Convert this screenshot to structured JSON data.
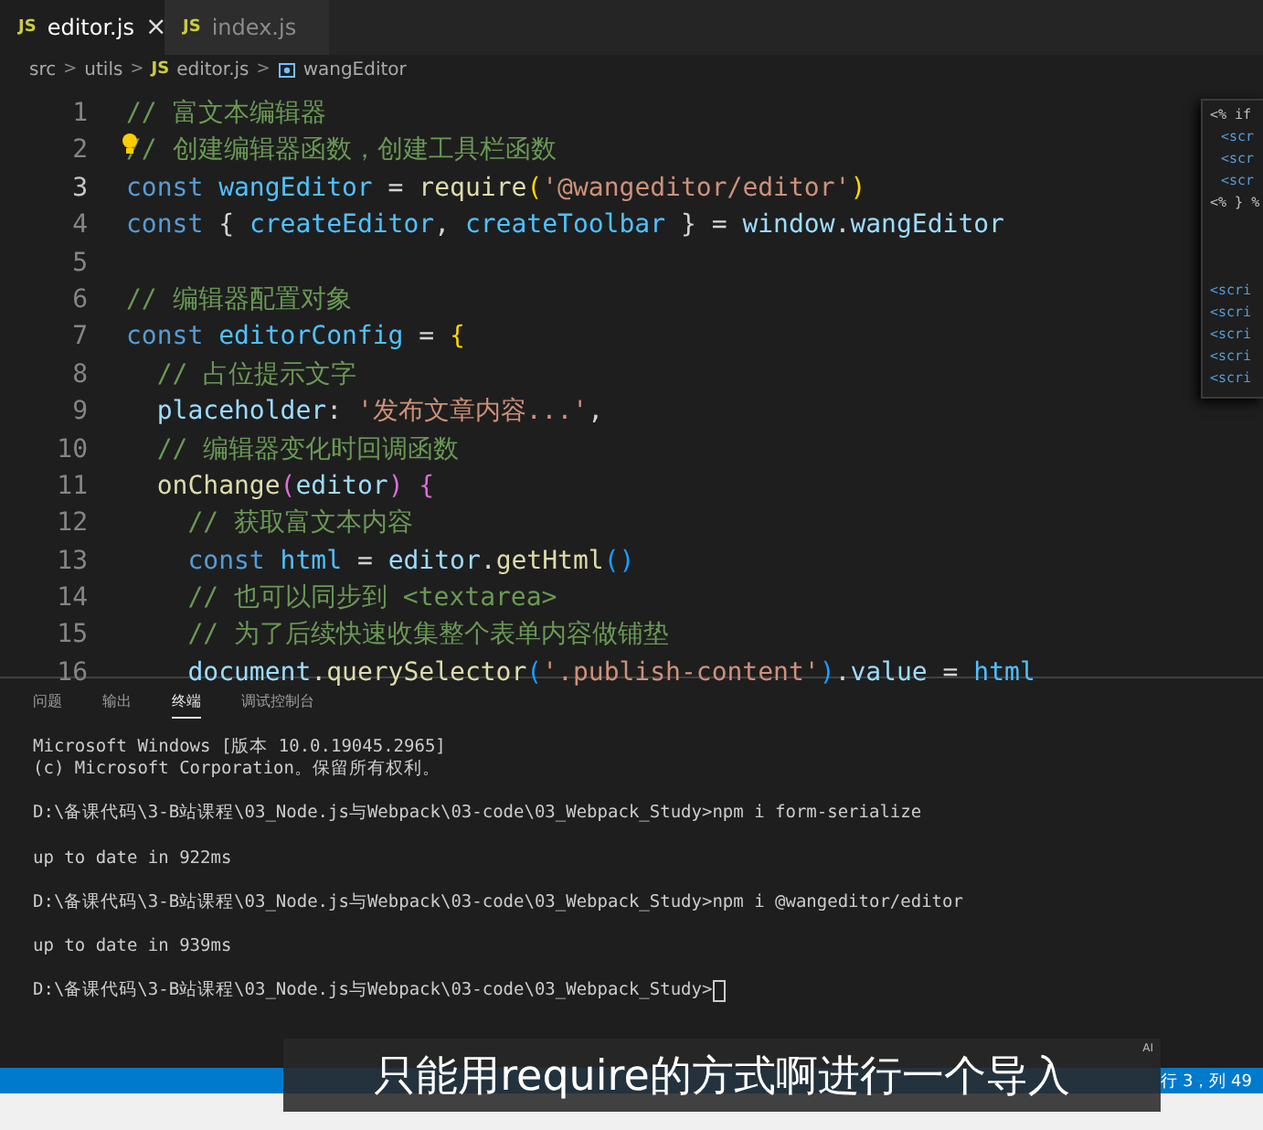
{
  "tabs": [
    {
      "label": "editor.js",
      "icon": "JS",
      "selected": true,
      "close": "×"
    },
    {
      "label": "index.js",
      "icon": "JS",
      "selected": false
    }
  ],
  "breadcrumb_separator": ">",
  "breadcrumb": [
    {
      "kind": "folder",
      "text": "src"
    },
    {
      "kind": "folder",
      "text": "utils"
    },
    {
      "kind": "file",
      "icon": "JS",
      "text": "editor.js"
    },
    {
      "kind": "symbol",
      "text": "wangEditor"
    }
  ],
  "code_lines": [
    {
      "number": "1",
      "current": false,
      "tokens": [
        {
          "kind": "comment",
          "text": "// 富文本编辑器"
        }
      ]
    },
    {
      "number": "2",
      "current": false,
      "lightbulb": true,
      "tokens": [
        {
          "kind": "comment",
          "text": "// 创建编辑器函数，创建工具栏函数"
        }
      ]
    },
    {
      "number": "3",
      "current": true,
      "tokens": [
        {
          "kind": "keyword",
          "text": "const "
        },
        {
          "kind": "variable",
          "text": "wangEditor"
        },
        {
          "kind": "plain",
          "text": " = "
        },
        {
          "kind": "func",
          "text": "require"
        },
        {
          "kind": "bracket",
          "text": "("
        },
        {
          "kind": "string",
          "text": "'@wangeditor/editor'"
        },
        {
          "kind": "bracket",
          "text": ")"
        }
      ]
    },
    {
      "number": "4",
      "current": false,
      "tokens": [
        {
          "kind": "keyword",
          "text": "const "
        },
        {
          "kind": "plain",
          "text": "{ "
        },
        {
          "kind": "variable",
          "text": "createEditor"
        },
        {
          "kind": "plain",
          "text": ", "
        },
        {
          "kind": "variable",
          "text": "createToolbar"
        },
        {
          "kind": "plain",
          "text": " } = "
        },
        {
          "kind": "property",
          "text": "window"
        },
        {
          "kind": "plain",
          "text": "."
        },
        {
          "kind": "property",
          "text": "wangEditor"
        }
      ]
    },
    {
      "number": "5",
      "current": false
    },
    {
      "number": "6",
      "current": false,
      "tokens": [
        {
          "kind": "comment",
          "text": "// 编辑器配置对象"
        }
      ]
    },
    {
      "number": "7",
      "current": false,
      "tokens": [
        {
          "kind": "keyword",
          "text": "const "
        },
        {
          "kind": "variable",
          "text": "editorConfig"
        },
        {
          "kind": "plain",
          "text": " = "
        },
        {
          "kind": "bracket",
          "text": "{"
        }
      ]
    },
    {
      "number": "8",
      "current": false,
      "tokens": [
        {
          "kind": "comment",
          "text": "  // 占位提示文字"
        }
      ]
    },
    {
      "number": "9",
      "current": false,
      "tokens": [
        {
          "kind": "property",
          "text": "  placeholder"
        },
        {
          "kind": "plain",
          "text": ": "
        },
        {
          "kind": "string",
          "text": "'发布文章内容...'"
        },
        {
          "kind": "plain",
          "text": ","
        }
      ]
    },
    {
      "number": "10",
      "current": false,
      "tokens": [
        {
          "kind": "comment",
          "text": "  // 编辑器变化时回调函数"
        }
      ]
    },
    {
      "number": "11",
      "current": false,
      "tokens": [
        {
          "kind": "func",
          "text": "  onChange"
        },
        {
          "kind": "bracket2",
          "text": "("
        },
        {
          "kind": "property",
          "text": "editor"
        },
        {
          "kind": "bracket2",
          "text": ") {"
        }
      ]
    },
    {
      "number": "12",
      "current": false,
      "tokens": [
        {
          "kind": "comment",
          "text": "    // 获取富文本内容"
        }
      ]
    },
    {
      "number": "13",
      "current": false,
      "tokens": [
        {
          "kind": "keyword",
          "text": "    const "
        },
        {
          "kind": "variable",
          "text": "html"
        },
        {
          "kind": "plain",
          "text": " = "
        },
        {
          "kind": "property",
          "text": "editor"
        },
        {
          "kind": "plain",
          "text": "."
        },
        {
          "kind": "func",
          "text": "getHtml"
        },
        {
          "kind": "bracket3",
          "text": "()"
        }
      ]
    },
    {
      "number": "14",
      "current": false,
      "tokens": [
        {
          "kind": "comment",
          "text": "    // 也可以同步到 <textarea>"
        }
      ]
    },
    {
      "number": "15",
      "current": false,
      "tokens": [
        {
          "kind": "comment",
          "text": "    // 为了后续快速收集整个表单内容做铺垫"
        }
      ]
    },
    {
      "number": "16",
      "current": false,
      "tokens": [
        {
          "kind": "property",
          "text": "    document"
        },
        {
          "kind": "plain",
          "text": "."
        },
        {
          "kind": "func",
          "text": "querySelector"
        },
        {
          "kind": "bracket3",
          "text": "("
        },
        {
          "kind": "string",
          "text": "'.publish-content'"
        },
        {
          "kind": "bracket3",
          "text": ")"
        },
        {
          "kind": "plain",
          "text": "."
        },
        {
          "kind": "property",
          "text": "value"
        },
        {
          "kind": "plain",
          "text": " = "
        },
        {
          "kind": "variable",
          "text": "html"
        }
      ]
    }
  ],
  "peek_lines": [
    {
      "kind": "tag",
      "text": "<% if"
    },
    {
      "kind": "script",
      "text": "<scr"
    },
    {
      "kind": "script",
      "text": "<scr"
    },
    {
      "kind": "script",
      "text": "<scr"
    },
    {
      "kind": "tag",
      "text": "<% } %"
    },
    {
      "kind": "gap",
      "text": "<scri"
    },
    {
      "kind": "script",
      "text": "<scri"
    },
    {
      "kind": "script",
      "text": "<scri"
    },
    {
      "kind": "script",
      "text": "<scri"
    },
    {
      "kind": "script",
      "text": "<scri"
    }
  ],
  "panel_tabs": [
    {
      "label": "问题",
      "selected": false
    },
    {
      "label": "输出",
      "selected": false
    },
    {
      "label": "终端",
      "selected": true
    },
    {
      "label": "调试控制台",
      "selected": false
    }
  ],
  "terminal_blocks": [
    [
      "Microsoft Windows [版本 10.0.19045.2965]",
      "(c) Microsoft Corporation。保留所有权利。"
    ],
    [
      "D:\\备课代码\\3-B站课程\\03_Node.js与Webpack\\03-code\\03_Webpack_Study>npm i form-serialize"
    ],
    [
      "up to date in 922ms"
    ],
    [
      "D:\\备课代码\\3-B站课程\\03_Node.js与Webpack\\03-code\\03_Webpack_Study>npm i @wangeditor/editor"
    ],
    [
      "up to date in 939ms"
    ],
    [
      "D:\\备课代码\\3-B站课程\\03_Node.js与Webpack\\03-code\\03_Webpack_Study>"
    ]
  ],
  "status_bar": {
    "position": "行 3，列 49"
  },
  "subtitle": {
    "text": "只能用require的方式啊进行一个导入",
    "badge": "AI"
  }
}
